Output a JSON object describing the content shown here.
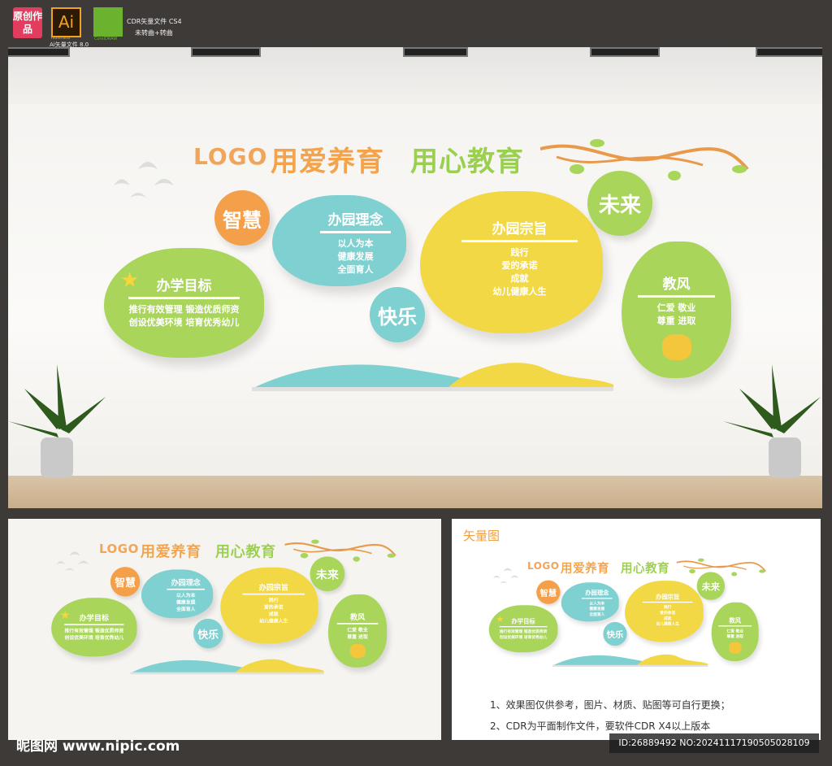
{
  "header": {
    "badge": "原创作品",
    "ai_icon": "Ai",
    "ai_caption": "Illustrator",
    "ai_label": "Ai矢量文件 8.0",
    "cdr_caption": "CorelDRAW",
    "cdr_title": "CDR矢量文件 CS4",
    "cdr_sub": "未转曲+转曲"
  },
  "wall": {
    "logo": "LOGO",
    "slogan1": "用爱养育",
    "slogan2": "用心教育",
    "wisdom": "智慧",
    "happy": "快乐",
    "future": "未来",
    "philosophy": {
      "title": "办园理念",
      "lines": [
        "以人为本",
        "健康发展",
        "全面育人"
      ]
    },
    "goal": {
      "title": "办学目标",
      "lines": [
        "推行有效管理  锻造优质师资",
        "创设优美环境  培育优秀幼儿"
      ]
    },
    "purpose": {
      "title": "办园宗旨",
      "lines": [
        "践行",
        "爱的承诺",
        "成就",
        "幼儿健康人生"
      ]
    },
    "style": {
      "title": "教风",
      "lines": [
        "仁爱  敬业",
        "尊重  进取"
      ]
    }
  },
  "vector_label": "矢量图",
  "notes": [
    "1、效果图仅供参考，图片、材质、贴图等可自行更换；",
    "2、CDR为平面制作文件，要软件CDR X4以上版本"
  ],
  "watermark": "昵图网 www.nipic.com",
  "id_text": "ID:26889492 NO:20241117190505028109",
  "colors": {
    "orange": "#f4a04a",
    "teal": "#7fd0d0",
    "green": "#a9d55b",
    "yellow": "#f2d844"
  }
}
